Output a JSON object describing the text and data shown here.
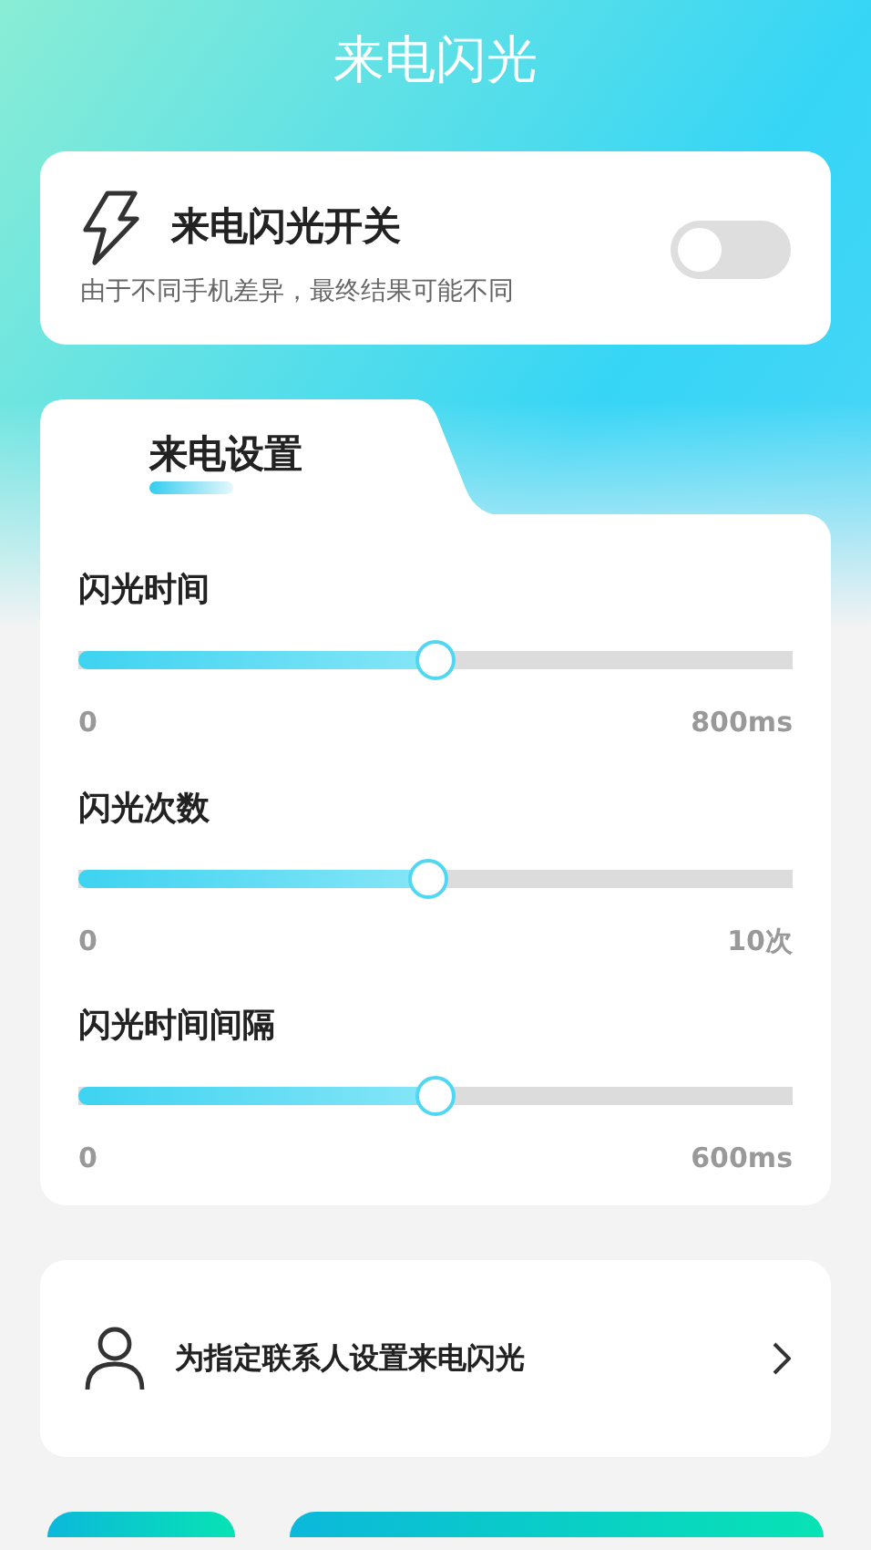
{
  "title": "来电闪光",
  "flash_card": {
    "title": "来电闪光开关",
    "note": "由于不同手机差异，最终结果可能不同",
    "on": false
  },
  "tabs": [
    {
      "label": "来电设置",
      "selected": true
    }
  ],
  "sliders": [
    {
      "label": "闪光时间",
      "level": 0.5,
      "min": "0",
      "max": "800ms"
    },
    {
      "label": "闪光次数",
      "level": 0.49,
      "min": "0",
      "max": "10次"
    },
    {
      "label": "闪光时间间隔",
      "level": 0.5,
      "min": "0",
      "max": "600ms"
    }
  ],
  "contact_row": {
    "label": "为指定联系人设置来电闪光"
  },
  "bottom_buttons": [
    {
      "kind": "small"
    },
    {
      "kind": "wide"
    }
  ]
}
